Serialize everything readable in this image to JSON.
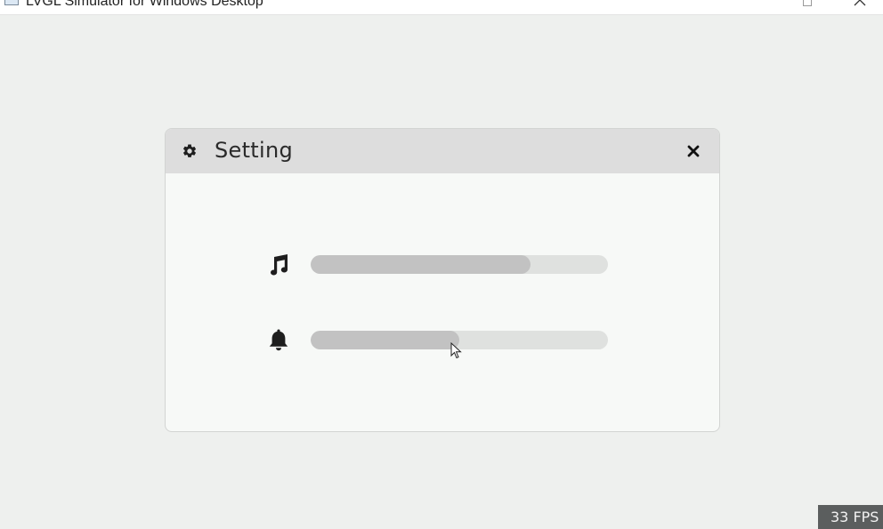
{
  "window": {
    "title": "LVGL Simulator for Windows Desktop",
    "icons": {
      "app": "app-window-icon",
      "maximize": "maximize-icon",
      "close": "close-icon"
    }
  },
  "dialog": {
    "title": "Setting",
    "icons": {
      "title": "gear-icon",
      "close": "close-icon"
    },
    "sliders": [
      {
        "icon": "music-note-icon",
        "value_percent": 74
      },
      {
        "icon": "bell-icon",
        "value_percent": 50
      }
    ]
  },
  "overlay": {
    "fps_label": "33 FPS"
  },
  "colors": {
    "background": "#eef0ee",
    "dialog_body": "#f7f9f7",
    "dialog_header": "#dddddd",
    "slider_track": "#dfe1df",
    "slider_fill": "#c2c2c2",
    "fps_background": "#5b5e5e"
  }
}
